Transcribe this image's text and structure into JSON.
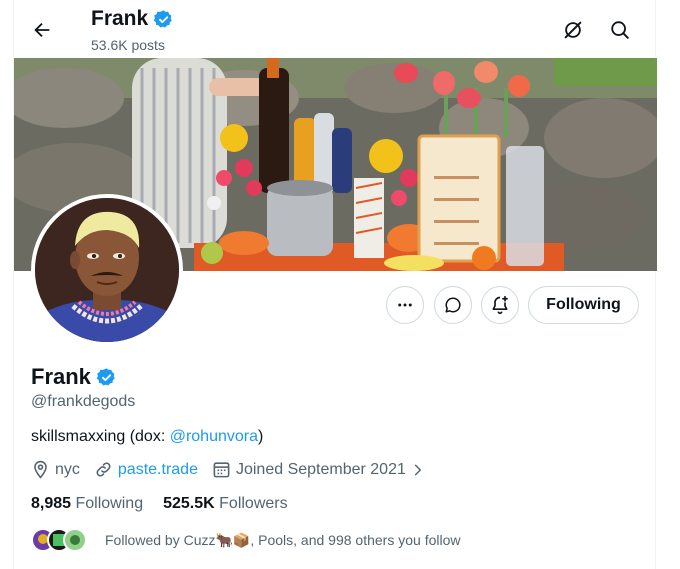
{
  "header": {
    "name": "Frank",
    "posts": "53.6K posts"
  },
  "actions": {
    "following_label": "Following"
  },
  "profile": {
    "name": "Frank",
    "handle": "@frankdegods",
    "bio_text": "skillsmaxxing (dox: ",
    "bio_mention": "@rohunvora",
    "bio_end": ")",
    "location": "nyc",
    "website": "paste.trade",
    "joined": "Joined September 2021"
  },
  "stats": {
    "following_count": "8,985",
    "following_label": "Following",
    "followers_count": "525.5K",
    "followers_label": "Followers"
  },
  "followed_by": {
    "text": "Followed by Cuzz🐂📦, Pools, and 998 others you follow"
  },
  "colors": {
    "accent": "#1d9bf0",
    "verified": "#1d9bf0",
    "secondary_text": "#536471"
  }
}
